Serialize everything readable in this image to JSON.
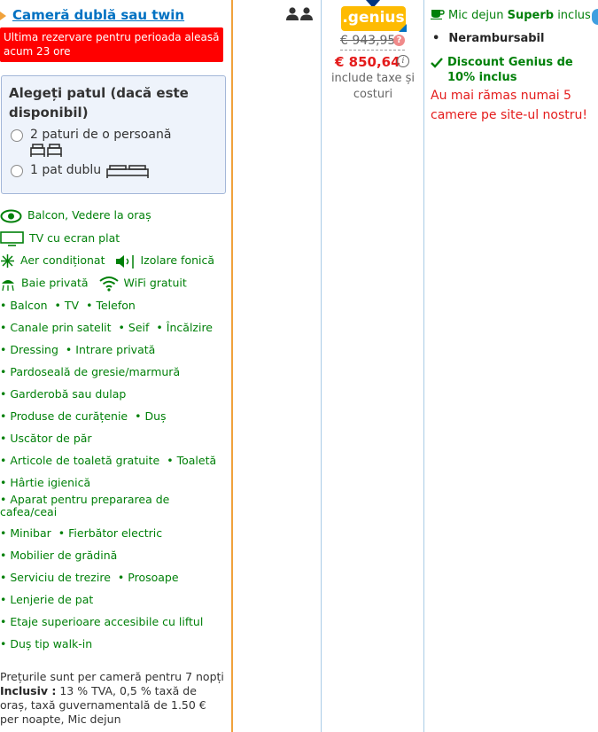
{
  "room": {
    "title": "Cameră dublă sau twin",
    "urgency": "Ultima rezervare pentru perioada aleasă acum 23 ore",
    "bed_choice_title": "Alegeți patul (dacă este disponibil)",
    "bed_options": [
      {
        "label": "2 paturi de o persoană"
      },
      {
        "label": "1 pat dublu"
      }
    ]
  },
  "facilities_icons": [
    {
      "label": "Balcon, Vedere la oraș",
      "icon": "eye-icon"
    },
    {
      "label": "TV cu ecran plat",
      "icon": "tv-icon"
    },
    {
      "label": "Aer condiționat",
      "icon": "snowflake-icon"
    },
    {
      "label": "Izolare fonică",
      "icon": "speaker-icon"
    },
    {
      "label": "Baie privată",
      "icon": "shower-icon"
    },
    {
      "label": "WiFi gratuit",
      "icon": "wifi-icon"
    }
  ],
  "facilities_rows": [
    [
      "Balcon",
      "TV",
      "Telefon"
    ],
    [
      "Canale prin satelit",
      "Seif",
      "Încălzire"
    ],
    [
      "Dressing",
      "Intrare privată"
    ],
    [
      "Pardoseală de gresie/marmură"
    ],
    [
      "Garderobă sau dulap"
    ],
    [
      "Produse de curățenie",
      "Duș"
    ],
    [
      "Uscător de păr"
    ],
    [
      "Articole de toaletă gratuite",
      "Toaletă"
    ],
    [
      "Hârtie igienică"
    ],
    [
      "Aparat pentru prepararea de cafea/ceai"
    ],
    [
      "Minibar",
      "Fierbător electric"
    ],
    [
      "Mobilier de grădină"
    ],
    [
      "Serviciu de trezire",
      "Prosoape"
    ],
    [
      "Lenjerie de pat"
    ],
    [
      "Etaje superioare accesibile cu liftul"
    ],
    [
      "Duș tip walk-in"
    ]
  ],
  "notes": {
    "line1": "Prețurile sunt per cameră pentru 7 nopți",
    "inclusive_label": "Inclusiv :",
    "inclusive_text": " 13 % TVA, 0,5 % taxă de oraș, taxă guvernamentală de 1.50 € per noapte, Mic dejun"
  },
  "price": {
    "badge": ".genius",
    "old": "€ 943,95",
    "new": "€ 850,64",
    "tax_note": "include taxe și costuri"
  },
  "conditions": {
    "breakfast_prefix": "Mic dejun ",
    "breakfast_bold": "Superb",
    "breakfast_suffix": " inclus",
    "refund": "Nerambursabil",
    "discount": "Discount Genius de 10% inclus",
    "scarcity": "Au mai rămas numai 5 camere pe site-ul nostru!"
  },
  "colors": {
    "link_blue": "#0071c2",
    "green": "#008009",
    "red": "#e41c1c",
    "genius_yellow": "#febb02"
  }
}
